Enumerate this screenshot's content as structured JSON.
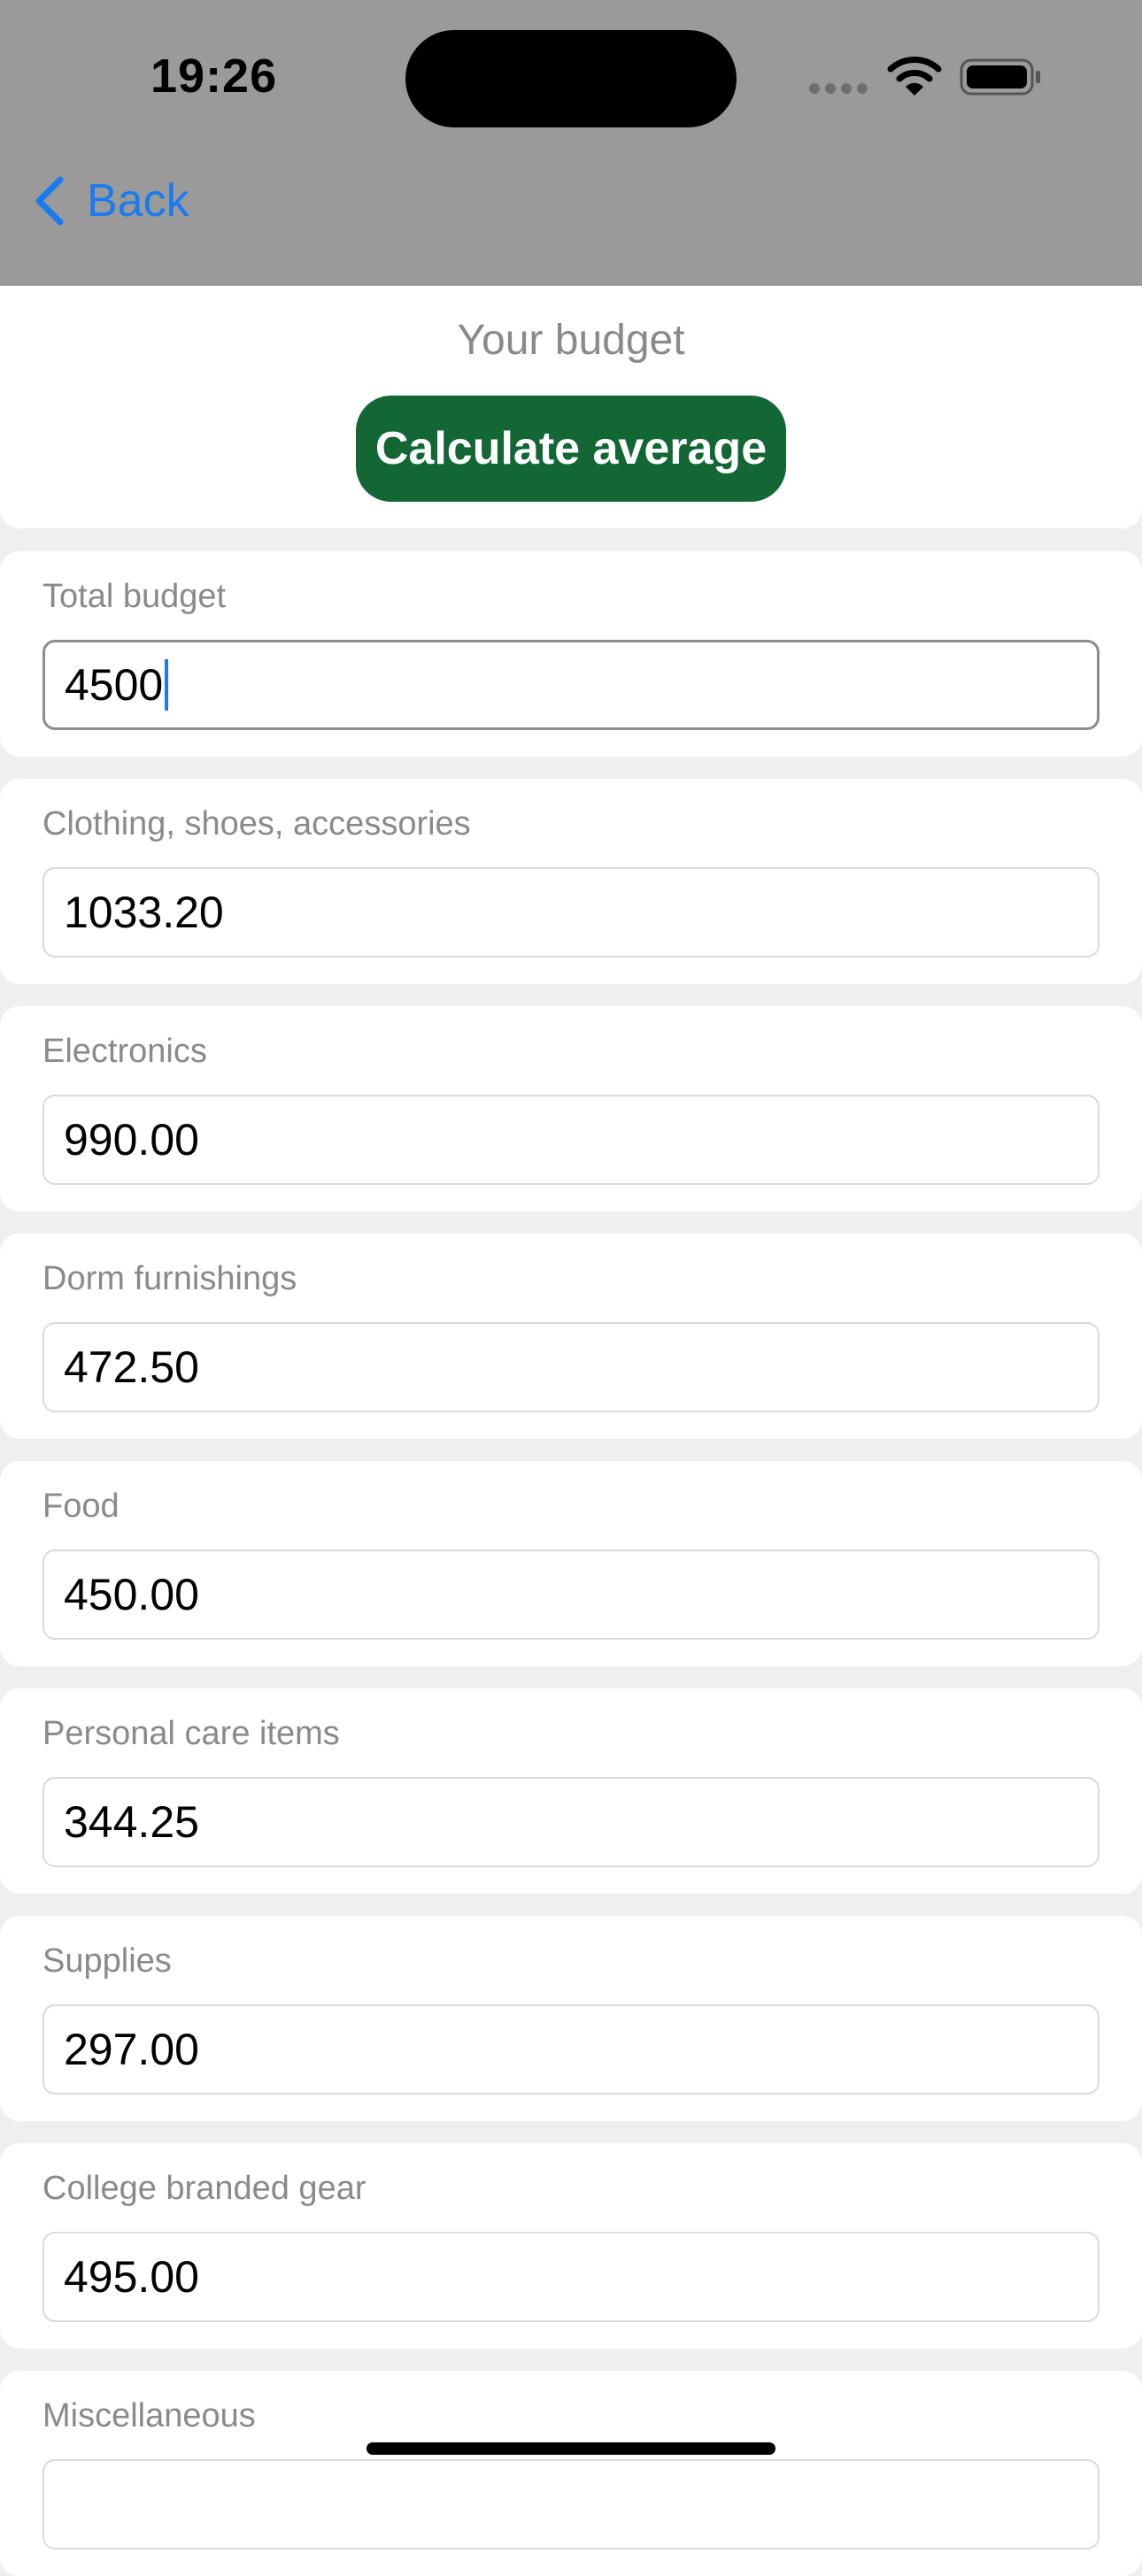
{
  "status_bar": {
    "time": "19:26",
    "icons": [
      "cellular-signal-icon",
      "wifi-icon",
      "battery-icon"
    ]
  },
  "nav": {
    "back_label": "Back",
    "back_icon": "chevron-left-icon"
  },
  "header": {
    "title": "Your budget",
    "button_label": "Calculate average"
  },
  "colors": {
    "accent": "#1a7bf0",
    "button": "#126734",
    "header_bg": "#9a9a9a"
  },
  "fields": [
    {
      "label": "Total budget",
      "value": "4500",
      "focused": true
    },
    {
      "label": "Clothing, shoes, accessories",
      "value": "1033.20"
    },
    {
      "label": "Electronics",
      "value": "990.00"
    },
    {
      "label": "Dorm furnishings",
      "value": "472.50"
    },
    {
      "label": "Food",
      "value": "450.00"
    },
    {
      "label": "Personal care items",
      "value": "344.25"
    },
    {
      "label": "Supplies",
      "value": "297.00"
    },
    {
      "label": "College branded gear",
      "value": "495.00"
    },
    {
      "label": "Miscellaneous",
      "value": ""
    }
  ]
}
